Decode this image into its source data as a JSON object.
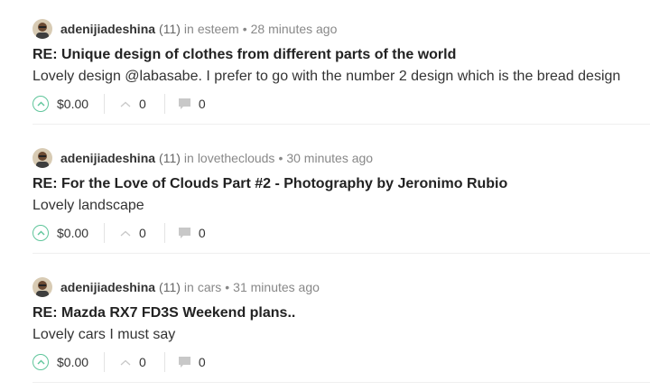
{
  "posts": [
    {
      "author": "adenijiadeshina",
      "reputation": "(11)",
      "in_word": "in",
      "community": "esteem",
      "time": "28 minutes ago",
      "title": "RE: Unique design of clothes from different parts of the world",
      "body": "Lovely design @labasabe. I prefer to go with the number 2 design which is the bread design",
      "payout": "$0.00",
      "votes": "0",
      "comments": "0"
    },
    {
      "author": "adenijiadeshina",
      "reputation": "(11)",
      "in_word": "in",
      "community": "lovetheclouds",
      "time": "30 minutes ago",
      "title": "RE: For the Love of Clouds Part #2 - Photography by Jeronimo Rubio",
      "body": "Lovely landscape",
      "payout": "$0.00",
      "votes": "0",
      "comments": "0"
    },
    {
      "author": "adenijiadeshina",
      "reputation": "(11)",
      "in_word": "in",
      "community": "cars",
      "time": "31 minutes ago",
      "title": "RE: Mazda RX7 FD3S Weekend plans..",
      "body": "Lovely cars I must say",
      "payout": "$0.00",
      "votes": "0",
      "comments": "0"
    }
  ],
  "separator": "•",
  "colors": {
    "upvote_green": "#5fc59b",
    "muted": "#888888",
    "divider": "#efefef"
  },
  "icons": {
    "upvote": "chevron-up-circle-icon",
    "votes": "chevron-up-icon",
    "comments": "comment-bubble-icon",
    "avatar": "user-avatar"
  }
}
